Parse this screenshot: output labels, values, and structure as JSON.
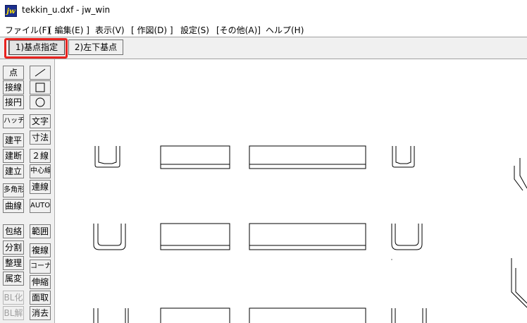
{
  "window": {
    "app_icon_text": "jw",
    "title": "tekkin_u.dxf - jw_win"
  },
  "menubar": {
    "items": [
      {
        "id": "file",
        "label": "ファイル(F)"
      },
      {
        "id": "edit",
        "label": "[ 編集(E) ]"
      },
      {
        "id": "view",
        "label": "表示(V)"
      },
      {
        "id": "draw",
        "label": "[ 作図(D) ]"
      },
      {
        "id": "settings",
        "label": "設定(S)"
      },
      {
        "id": "other",
        "label": "[その他(A)]"
      },
      {
        "id": "help",
        "label": "ヘルプ(H)"
      }
    ]
  },
  "toolbar": {
    "mode1_label": "1)基点指定",
    "mode2_label": "2)左下基点"
  },
  "colors": {
    "highlight": "#e8231f",
    "drawing_line": "#000000"
  },
  "left_panel": {
    "col1": [
      "点",
      "接線",
      "接円",
      "ハッチ",
      "建平",
      "建断",
      "建立",
      "多角形",
      "曲線",
      "包絡",
      "分割",
      "整理",
      "属変",
      "BL化",
      "BL解"
    ],
    "col2": [
      "/",
      "□",
      "○",
      "文字",
      "寸法",
      "２線",
      "中心線",
      "連線",
      "AUTO",
      "範囲",
      "複線",
      "コーナー",
      "伸縮",
      "面取",
      "消去"
    ],
    "col2_icons": [
      "line-icon",
      "rectangle-icon",
      "circle-icon"
    ],
    "disabled": [
      "BL化",
      "BL解"
    ]
  }
}
